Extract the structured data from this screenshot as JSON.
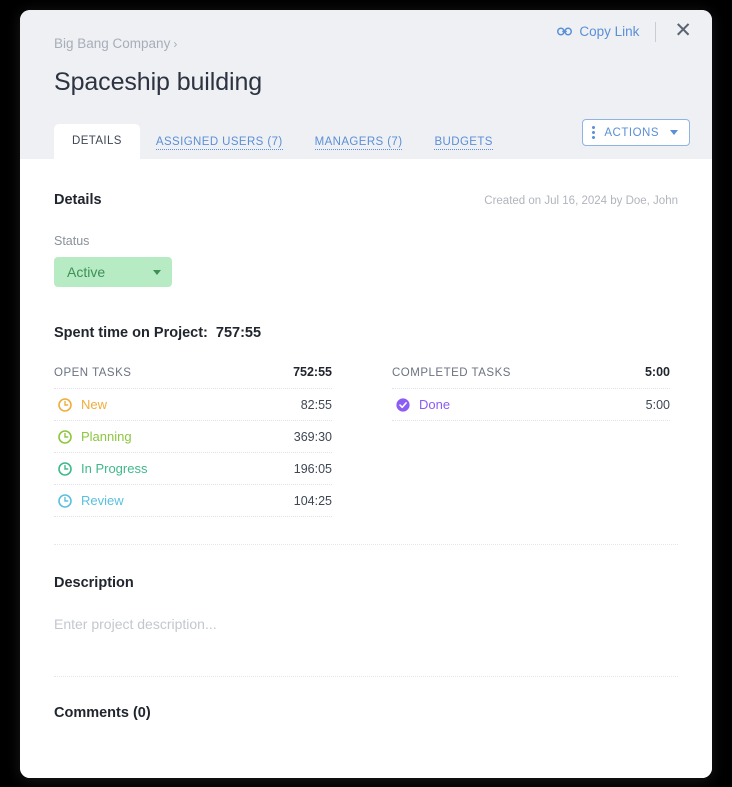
{
  "header": {
    "breadcrumb": "Big Bang Company",
    "breadcrumb_caret": "›",
    "title": "Spaceship building",
    "copy_link_label": "Copy Link",
    "copy_link_icon": "link-icon",
    "close_icon": "✕",
    "actions_label": "ACTIONS",
    "actions_icon": "vertical-dots-icon"
  },
  "tabs": [
    {
      "label": "DETAILS",
      "active": true
    },
    {
      "label": "ASSIGNED USERS (7)",
      "active": false
    },
    {
      "label": "MANAGERS (7)",
      "active": false
    },
    {
      "label": "BUDGETS",
      "active": false
    }
  ],
  "details": {
    "section_title": "Details",
    "created_meta": "Created on Jul 16, 2024 by Doe, John",
    "status_label": "Status",
    "status_value": "Active",
    "status_bg": "#b6ebc3",
    "status_fg": "#3f8f57"
  },
  "spent_time": {
    "label": "Spent time on Project:",
    "total": "757:55",
    "open": {
      "header": "OPEN TASKS",
      "total": "752:55",
      "rows": [
        {
          "name": "New",
          "value": "82:55",
          "color": "#f0ad3e",
          "icon": "clock-icon"
        },
        {
          "name": "Planning",
          "value": "369:30",
          "color": "#8dc63f",
          "icon": "clock-icon"
        },
        {
          "name": "In Progress",
          "value": "196:05",
          "color": "#3fb98a",
          "icon": "clock-icon"
        },
        {
          "name": "Review",
          "value": "104:25",
          "color": "#5bc0de",
          "icon": "clock-icon"
        }
      ]
    },
    "completed": {
      "header": "COMPLETED TASKS",
      "total": "5:00",
      "rows": [
        {
          "name": "Done",
          "value": "5:00",
          "color": "#8b5cf6",
          "icon": "check-circle-icon"
        }
      ]
    }
  },
  "description": {
    "title": "Description",
    "placeholder": "Enter project description..."
  },
  "comments": {
    "title": "Comments (0)"
  }
}
